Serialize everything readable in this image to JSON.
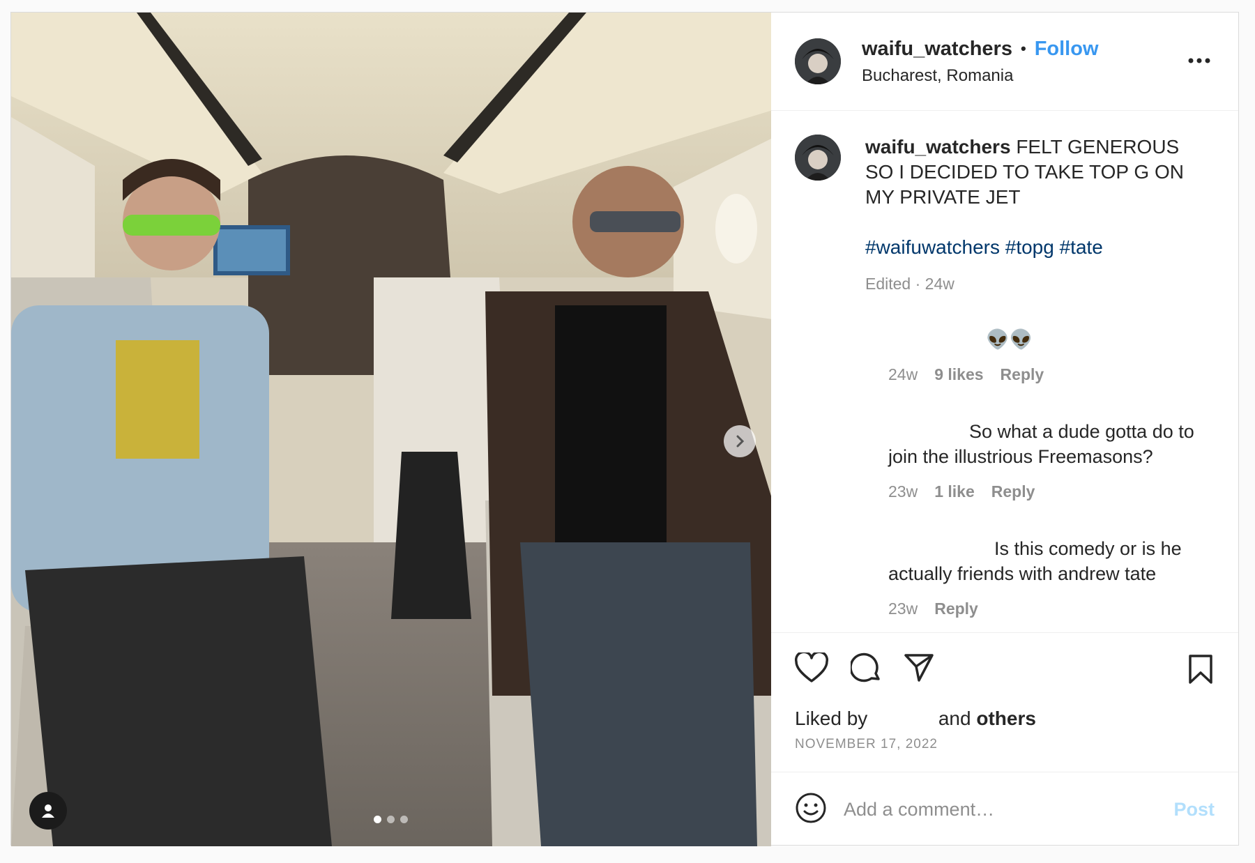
{
  "header": {
    "username": "waifu_watchers",
    "separator": "•",
    "follow_label": "Follow",
    "location": "Bucharest, Romania"
  },
  "caption": {
    "username": "waifu_watchers",
    "text": "FELT GENEROUS SO I DECIDED TO TAKE TOP G ON MY PRIVATE JET",
    "hashtags": "#waifuwatchers #topg #tate",
    "meta": "Edited · 24w"
  },
  "comments": [
    {
      "username": "",
      "text": "👽👽",
      "age": "24w",
      "likes": "9 likes",
      "reply": "Reply"
    },
    {
      "username": "",
      "text": "So what a dude gotta do to join the illustrious Freemasons?",
      "age": "23w",
      "likes": "1 like",
      "reply": "Reply"
    },
    {
      "username": "",
      "text": "Is this comedy or is he actually friends with andrew tate",
      "age": "23w",
      "likes": "",
      "reply": "Reply"
    }
  ],
  "footer": {
    "liked_prefix": "Liked by",
    "liked_user": "",
    "liked_suffix": "and",
    "liked_others": "others",
    "date": "NOVEMBER 17, 2022"
  },
  "add_comment": {
    "placeholder": "Add a comment…",
    "post_label": "Post"
  },
  "carousel": {
    "current": 1,
    "total": 3
  },
  "icons": {
    "more": "more-options-icon",
    "like": "heart-icon",
    "comment": "comment-icon",
    "share": "share-icon",
    "save": "bookmark-icon",
    "emoji": "emoji-icon",
    "next": "chevron-right-icon",
    "tag": "user-tag-icon"
  },
  "colors": {
    "follow": "#3897f0",
    "hashtag": "#00376b",
    "post_disabled": "#b2dffc",
    "meta": "#8e8e8e"
  }
}
